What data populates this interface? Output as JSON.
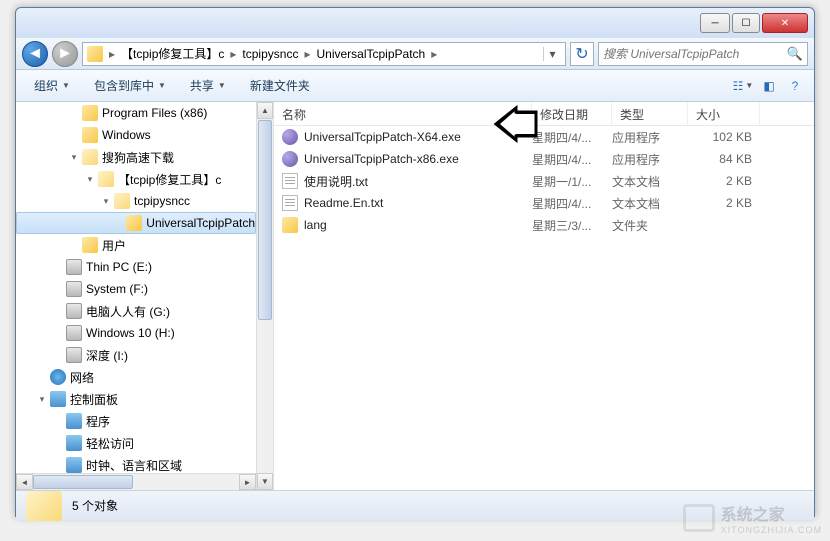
{
  "breadcrumb": {
    "items": [
      "【tcpip修复工具】c",
      "tcpipysncc",
      "UniversalTcpipPatch"
    ]
  },
  "search": {
    "placeholder": "搜索 UniversalTcpipPatch"
  },
  "toolbar": {
    "organize": "组织",
    "include": "包含到库中",
    "share": "共享",
    "newfolder": "新建文件夹"
  },
  "columns": {
    "name": "名称",
    "date": "修改日期",
    "type": "类型",
    "size": "大小"
  },
  "tree": [
    {
      "indent": 1,
      "exp": "",
      "icon": "folder",
      "label": "Program Files (x86)"
    },
    {
      "indent": 1,
      "exp": "",
      "icon": "folder",
      "label": "Windows"
    },
    {
      "indent": 1,
      "exp": "▾",
      "icon": "folder-open",
      "label": "搜狗高速下载"
    },
    {
      "indent": 2,
      "exp": "▾",
      "icon": "folder-open",
      "label": "【tcpip修复工具】c"
    },
    {
      "indent": 3,
      "exp": "▾",
      "icon": "folder-open",
      "label": "tcpipysncc"
    },
    {
      "indent": 4,
      "exp": "",
      "icon": "folder",
      "label": "UniversalTcpipPatch",
      "selected": true
    },
    {
      "indent": 1,
      "exp": "",
      "icon": "folder",
      "label": "用户"
    },
    {
      "indent": 0,
      "exp": "",
      "icon": "drive",
      "label": "Thin PC (E:)"
    },
    {
      "indent": 0,
      "exp": "",
      "icon": "drive",
      "label": "System (F:)"
    },
    {
      "indent": 0,
      "exp": "",
      "icon": "drive",
      "label": "电脑人人有 (G:)"
    },
    {
      "indent": 0,
      "exp": "",
      "icon": "drive",
      "label": "Windows 10 (H:)"
    },
    {
      "indent": 0,
      "exp": "",
      "icon": "drive",
      "label": "深度 (I:)"
    },
    {
      "indent": -1,
      "exp": "",
      "icon": "net",
      "label": "网络"
    },
    {
      "indent": -1,
      "exp": "▾",
      "icon": "cp",
      "label": "控制面板"
    },
    {
      "indent": 0,
      "exp": "",
      "icon": "cp",
      "label": "程序"
    },
    {
      "indent": 0,
      "exp": "",
      "icon": "cp",
      "label": "轻松访问"
    },
    {
      "indent": 0,
      "exp": "",
      "icon": "cp",
      "label": "时钟、语言和区域"
    }
  ],
  "files": [
    {
      "icon": "exe",
      "name": "UniversalTcpipPatch-X64.exe",
      "date": "星期四/4/...",
      "type": "应用程序",
      "size": "102 KB"
    },
    {
      "icon": "exe",
      "name": "UniversalTcpipPatch-x86.exe",
      "date": "星期四/4/...",
      "type": "应用程序",
      "size": "84 KB"
    },
    {
      "icon": "txt",
      "name": "使用说明.txt",
      "date": "星期一/1/...",
      "type": "文本文档",
      "size": "2 KB"
    },
    {
      "icon": "txt",
      "name": "Readme.En.txt",
      "date": "星期四/4/...",
      "type": "文本文档",
      "size": "2 KB"
    },
    {
      "icon": "fld",
      "name": "lang",
      "date": "星期三/3/...",
      "type": "文件夹",
      "size": ""
    }
  ],
  "status": {
    "count": "5 个对象"
  },
  "watermark": {
    "text": "系统之家",
    "sub": "XITONGZHIJIA.COM"
  }
}
